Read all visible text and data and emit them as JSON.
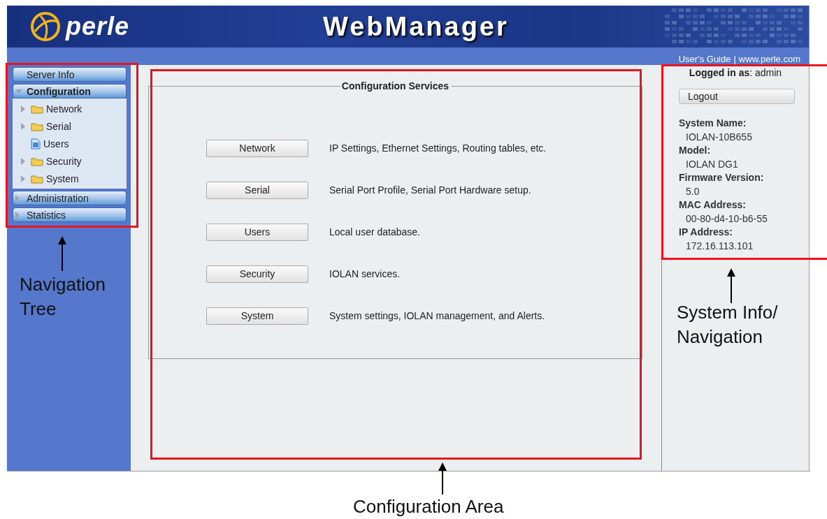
{
  "header": {
    "logo": "perle",
    "title": "WebManager",
    "links": [
      "User's Guide",
      "www.perle.com"
    ],
    "link_separator": "|"
  },
  "navigation": [
    {
      "label": "Server Info",
      "kind": "link",
      "selected": false
    },
    {
      "label": "Configuration",
      "kind": "group",
      "selected": true,
      "expanded": true,
      "children": [
        {
          "label": "Network",
          "kind": "folder",
          "expanded": false
        },
        {
          "label": "Serial",
          "kind": "folder",
          "expanded": false
        },
        {
          "label": "Users",
          "kind": "page"
        },
        {
          "label": "Security",
          "kind": "folder",
          "expanded": false
        },
        {
          "label": "System",
          "kind": "folder",
          "expanded": false
        }
      ]
    },
    {
      "label": "Administration",
      "kind": "group",
      "selected": false,
      "expanded": false
    },
    {
      "label": "Statistics",
      "kind": "group",
      "selected": false,
      "expanded": false
    }
  ],
  "config_services": {
    "title": "Configuration Services",
    "rows": [
      {
        "button": "Network",
        "description": "IP Settings, Ethernet Settings, Routing tables, etc."
      },
      {
        "button": "Serial",
        "description": "Serial Port Profile, Serial Port Hardware setup."
      },
      {
        "button": "Users",
        "description": "Local user database."
      },
      {
        "button": "Security",
        "description": "IOLAN services."
      },
      {
        "button": "System",
        "description": "System settings, IOLAN management, and Alerts."
      }
    ]
  },
  "system_info": {
    "logged_in": "**Logged in as**: admin",
    "logout_button": "Logout",
    "fields": [
      {
        "label": "System Name:",
        "value": "IOLAN-10B655"
      },
      {
        "label": "Model:",
        "value": "IOLAN DG1"
      },
      {
        "label": "Firmware Version:",
        "value": "5.0"
      },
      {
        "label": "MAC Address:",
        "value": "00-80-d4-10-b6-55"
      },
      {
        "label": "IP Address:",
        "value": "172.16.113.101"
      }
    ]
  },
  "annotations": [
    {
      "label": "Navigation Tree"
    },
    {
      "label": "Configuration Area"
    },
    {
      "label": "System Info/ Navigation"
    }
  ]
}
